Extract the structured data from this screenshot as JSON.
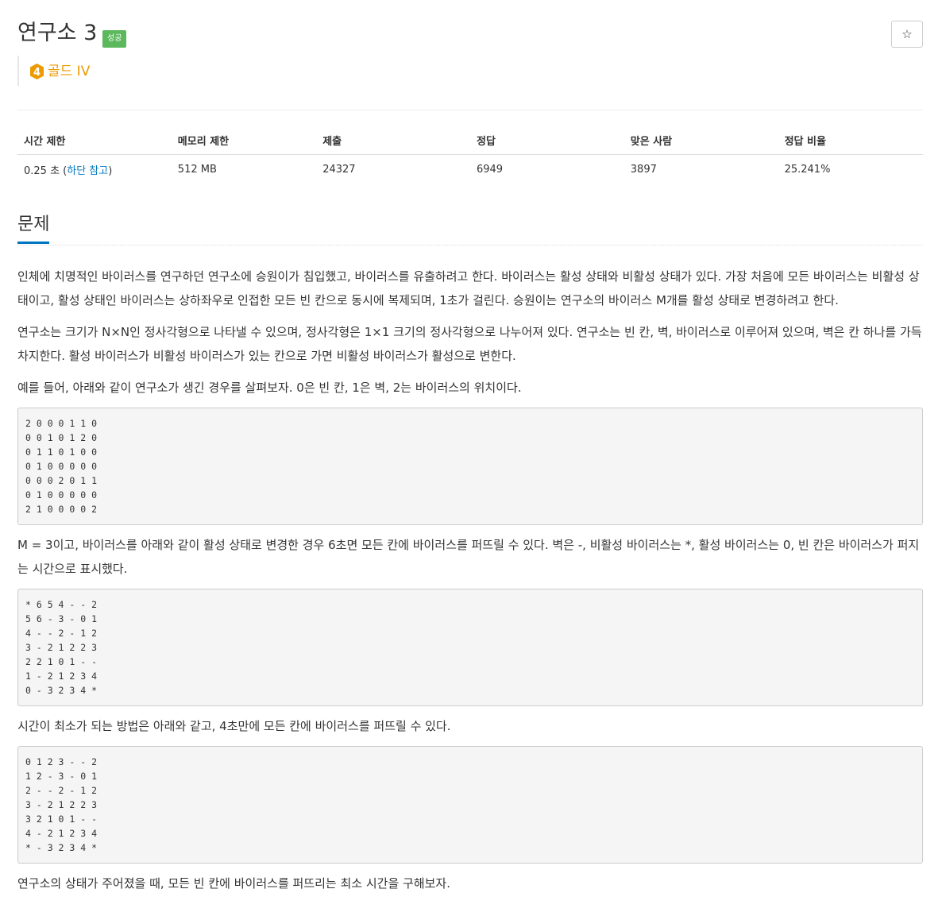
{
  "problem": {
    "title": "연구소 3",
    "status_badge": "성공",
    "star_icon": "☆",
    "tier": {
      "number": "4",
      "label": "골드 IV",
      "color": "#ec9a00"
    }
  },
  "info_table": {
    "headers": [
      "시간 제한",
      "메모리 제한",
      "제출",
      "정답",
      "맞은 사람",
      "정답 비율"
    ],
    "time_limit_value": "0.25 초 (",
    "time_limit_link": "하단 참고",
    "time_limit_close": ")",
    "memory_limit": "512 MB",
    "submissions": "24327",
    "accepted": "6949",
    "solvers": "3897",
    "ratio": "25.241%"
  },
  "section": {
    "title": "문제"
  },
  "content": {
    "p1": "인체에 치명적인 바이러스를 연구하던 연구소에 승원이가 침입했고, 바이러스를 유출하려고 한다. 바이러스는 활성 상태와 비활성 상태가 있다. 가장 처음에 모든 바이러스는 비활성 상태이고, 활성 상태인 바이러스는 상하좌우로 인접한 모든 빈 칸으로 동시에 복제되며, 1초가 걸린다. 승원이는 연구소의 바이러스 M개를 활성 상태로 변경하려고 한다.",
    "p2": "연구소는 크기가 N×N인 정사각형으로 나타낼 수 있으며, 정사각형은 1×1 크기의 정사각형으로 나누어져 있다. 연구소는 빈 칸, 벽, 바이러스로 이루어져 있으며, 벽은 칸 하나를 가득 차지한다. 활성 바이러스가 비활성 바이러스가 있는 칸으로 가면 비활성 바이러스가 활성으로 변한다.",
    "p3": "예를 들어, 아래와 같이 연구소가 생긴 경우를 살펴보자. 0은 빈 칸, 1은 벽, 2는 바이러스의 위치이다.",
    "grid1": "2 0 0 0 1 1 0\n0 0 1 0 1 2 0\n0 1 1 0 1 0 0\n0 1 0 0 0 0 0\n0 0 0 2 0 1 1\n0 1 0 0 0 0 0\n2 1 0 0 0 0 2",
    "p4": "M = 3이고, 바이러스를 아래와 같이 활성 상태로 변경한 경우 6초면 모든 칸에 바이러스를 퍼뜨릴 수 있다. 벽은 -, 비활성 바이러스는 *, 활성 바이러스는 0, 빈 칸은 바이러스가 퍼지는 시간으로 표시했다.",
    "grid2": "* 6 5 4 - - 2\n5 6 - 3 - 0 1\n4 - - 2 - 1 2\n3 - 2 1 2 2 3\n2 2 1 0 1 - -\n1 - 2 1 2 3 4\n0 - 3 2 3 4 *",
    "p5": "시간이 최소가 되는 방법은 아래와 같고, 4초만에 모든 칸에 바이러스를 퍼뜨릴 수 있다.",
    "grid3": "0 1 2 3 - - 2\n1 2 - 3 - 0 1\n2 - - 2 - 1 2\n3 - 2 1 2 2 3\n3 2 1 0 1 - -\n4 - 2 1 2 3 4\n* - 3 2 3 4 *",
    "p6": "연구소의 상태가 주어졌을 때, 모든 빈 칸에 바이러스를 퍼뜨리는 최소 시간을 구해보자."
  }
}
